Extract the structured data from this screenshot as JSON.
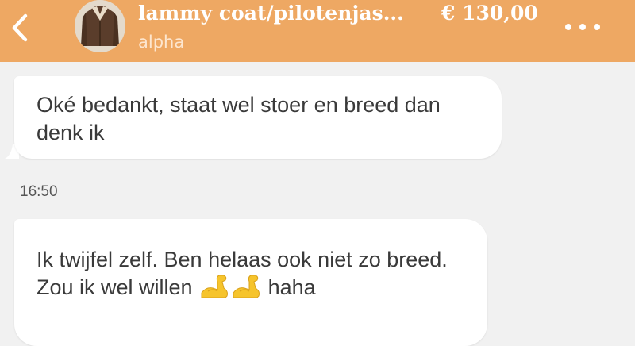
{
  "header": {
    "title": "lammy coat/pilotenjas...",
    "price": "€ 130,00",
    "subtitle": "alpha",
    "back_icon": "chevron-left-icon",
    "more_icon": "more-horizontal-icon",
    "background_color": "#eea863"
  },
  "messages": [
    {
      "text": "Oké bedankt, staat wel stoer en breed dan denk ik"
    },
    {
      "timestamp": "16:50"
    },
    {
      "text_before": "Ik twijfel zelf. Ben helaas ook niet zo breed. Zou ik wel willen",
      "emoji": "flexed-biceps-icon",
      "emoji_count": 2,
      "text_after": "haha"
    }
  ]
}
